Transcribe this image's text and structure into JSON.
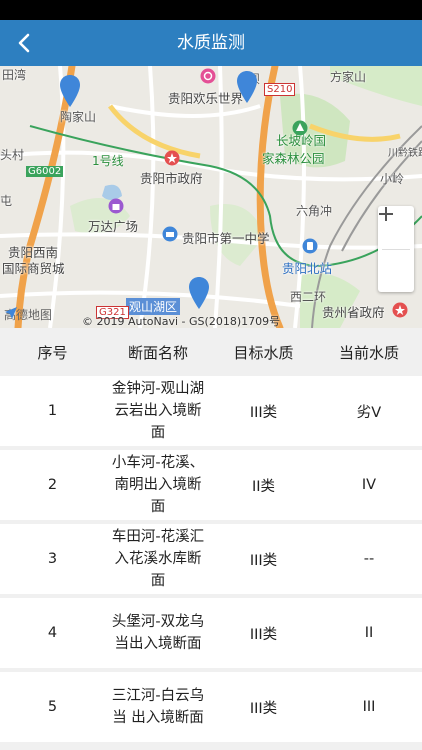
{
  "header": {
    "title": "水质监测"
  },
  "map": {
    "labels": {
      "l1": "贵阳欢乐世界",
      "l2": "长坡岭国",
      "l3": "家森林公园",
      "l4": "贵阳市政府",
      "l5": "万达广场",
      "l6": "贵阳市第一中学",
      "l7": "贵阳西南",
      "l8": "国际商贸城",
      "l9": "贵阳北站",
      "l10": "观山湖区",
      "l11": "贵州省政府",
      "l12": "陶家山",
      "l13": "方家山",
      "l14": "1号线",
      "l15": "六角冲",
      "l16": "头村",
      "l17": "西二环",
      "l18": "屯",
      "l19": "田湾",
      "l20": "小岭",
      "l21": "坝",
      "l22": "川黔铁路"
    },
    "roads": {
      "r1": "G6002",
      "r2": "S210",
      "r3": "G321"
    },
    "logo": "高德地图",
    "copyright": "© 2019 AutoNavi - GS(2018)1709号"
  },
  "table": {
    "headers": [
      "序号",
      "断面名称",
      "目标水质",
      "当前水质"
    ],
    "rows": [
      {
        "index": "1",
        "name": "金钟河-观山湖云岩出入境断面",
        "target": "III类",
        "current": "劣V"
      },
      {
        "index": "2",
        "name": "小车河-花溪、南明出入境断面",
        "target": "II类",
        "current": "IV"
      },
      {
        "index": "3",
        "name": "车田河-花溪汇入花溪水库断面",
        "target": "III类",
        "current": "--"
      },
      {
        "index": "4",
        "name": "头堡河-双龙乌当出入境断面",
        "target": "III类",
        "current": "II"
      },
      {
        "index": "5",
        "name": "三江河-白云乌当 出入境断面",
        "target": "III类",
        "current": "III"
      }
    ]
  },
  "colors": {
    "nav": "#2d7fc0",
    "marker": "#3f86d9",
    "road_orange": "#f0a24a",
    "metro": "#3aa35c"
  }
}
